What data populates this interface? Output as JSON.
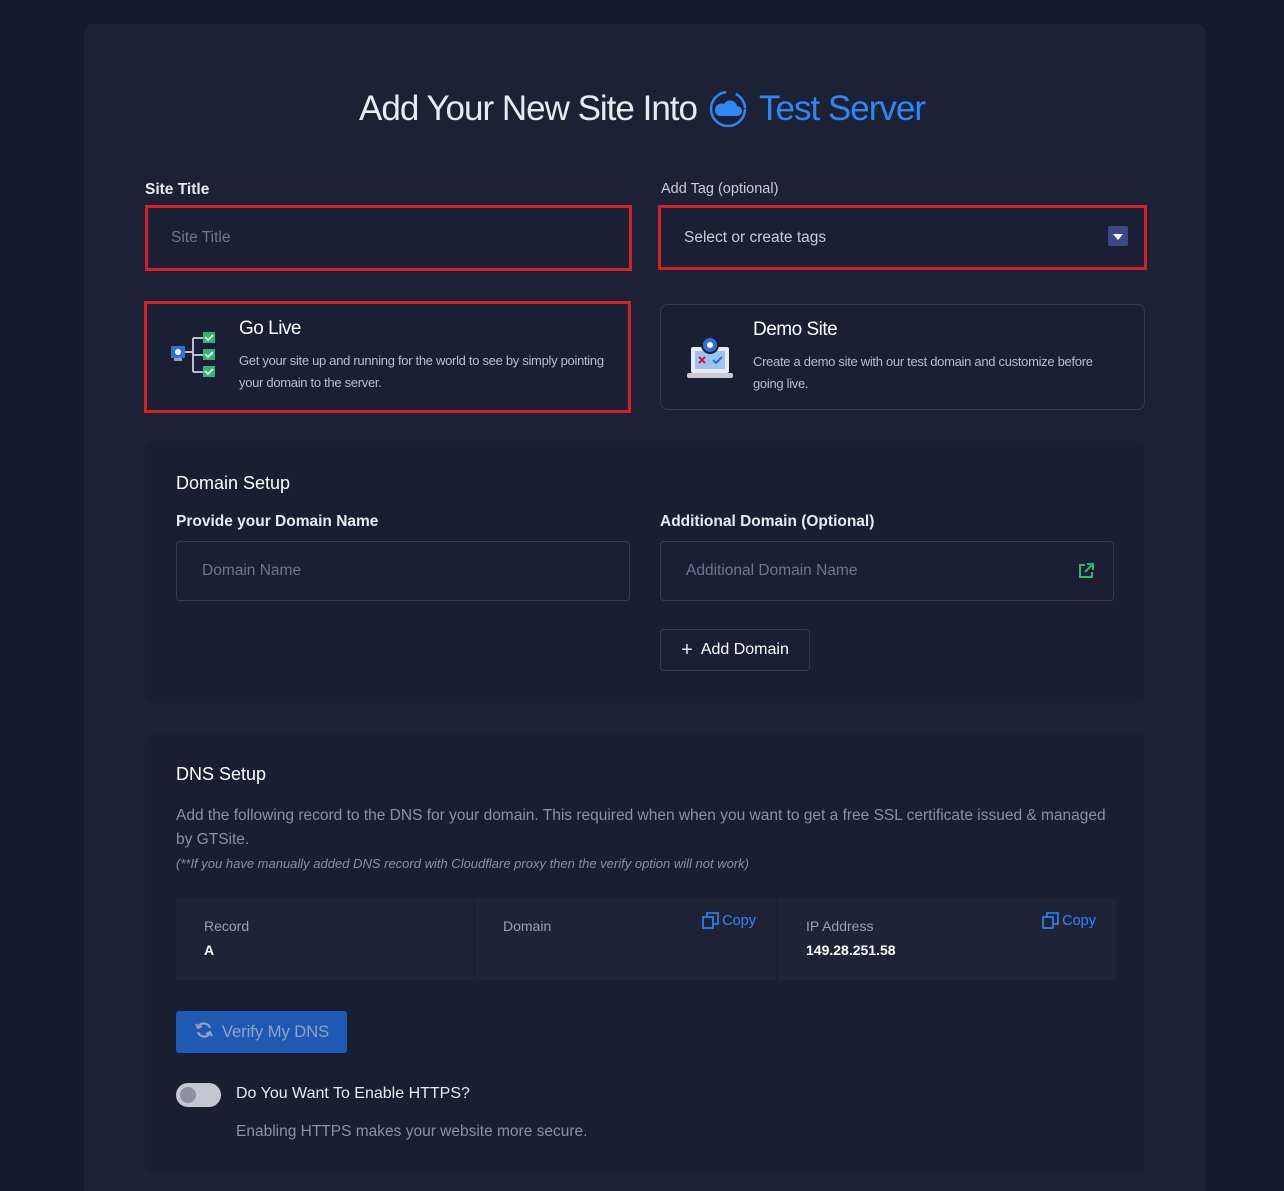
{
  "heading": {
    "prefix": "Add Your New Site Into",
    "server_name": "Test Server",
    "server_icon": "cloud-icon"
  },
  "site_title": {
    "label": "Site Title",
    "placeholder": "Site Title"
  },
  "tags": {
    "label": "Add Tag (optional)",
    "placeholder": "Select or create tags"
  },
  "options": [
    {
      "title": "Go Live",
      "description": "Get your site up and running for the world to see by simply pointing your domain to the server.",
      "icon": "network-checklist-icon",
      "highlighted": true
    },
    {
      "title": "Demo Site",
      "description": "Create a demo site with our test domain and customize before going live.",
      "icon": "laptop-settings-icon",
      "highlighted": false
    }
  ],
  "domain_setup": {
    "title": "Domain Setup",
    "domain_label": "Provide your Domain Name",
    "domain_placeholder": "Domain Name",
    "additional_label": "Additional Domain (Optional)",
    "additional_placeholder": "Additional Domain Name",
    "add_button": "Add Domain"
  },
  "dns_setup": {
    "title": "DNS Setup",
    "description": "Add the following record to the DNS for your domain. This required when when you want to get a free SSL certificate issued & managed by GTSite.",
    "note": "(**If you have manually added DNS record with Cloudflare proxy then the verify option will not work)",
    "record": {
      "label": "Record",
      "value": "A"
    },
    "domain": {
      "label": "Domain",
      "value": "",
      "copy_label": "Copy"
    },
    "ip": {
      "label": "IP Address",
      "value": "149.28.251.58",
      "copy_label": "Copy"
    },
    "verify_button": "Verify My DNS",
    "https_label": "Do You Want To Enable HTTPS?",
    "https_sub": "Enabling HTTPS makes your website more secure.",
    "https_enabled": false
  },
  "colors": {
    "accent": "#2f87f4",
    "highlight": "#d21f2a",
    "verify_bg": "#1f59b2",
    "success": "#2bb673"
  }
}
